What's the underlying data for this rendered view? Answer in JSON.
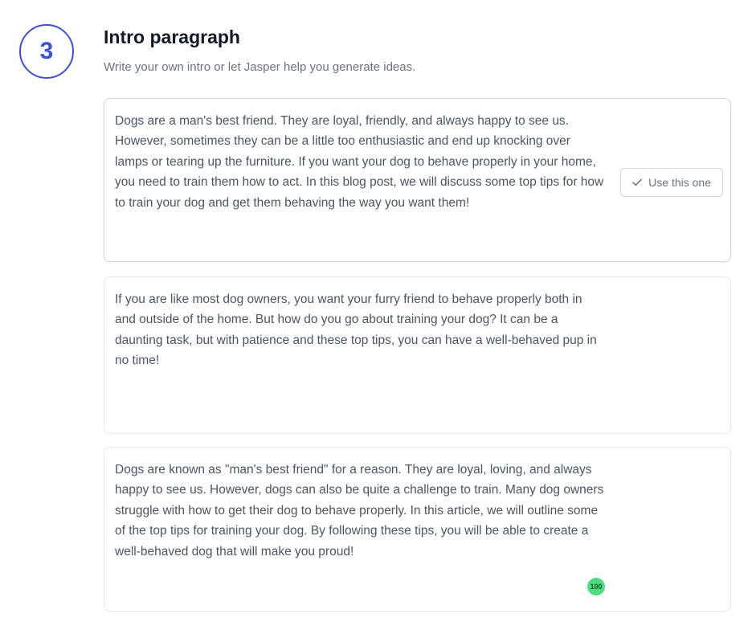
{
  "step": {
    "number": "3",
    "title": "Intro paragraph",
    "subtitle": "Write your own intro or let Jasper help you generate ideas."
  },
  "options": [
    {
      "text": "Dogs are a man's best friend. They are loyal, friendly, and always happy to see us. However, sometimes they can be a little too enthusiastic and end up knocking over lamps or tearing up the furniture. If you want your dog to behave properly in your home, you need to train them how to act. In this blog post, we will discuss some top tips for how to train your dog and get them behaving the way you want them!",
      "button_label": "Use this one",
      "button_icon": "check-icon"
    },
    {
      "text": "If you are like most dog owners, you want your furry friend to behave properly both in and outside of the home. But how do you go about training your dog? It can be a daunting task, but with patience and these top tips, you can have a well-behaved pup in no time!"
    },
    {
      "text": "Dogs are known as \"man's best friend\" for a reason. They are loyal, loving, and always happy to see us. However, dogs can also be quite a challenge to train. Many dog owners struggle with how to get their dog to behave properly. In this article, we will outline some of the top tips for training your dog. By following these tips, you will be able to create a well-behaved dog that will make you proud!",
      "score": "100"
    }
  ],
  "colors": {
    "accent": "#3b4fd8",
    "score_badge": "#4ade80"
  }
}
